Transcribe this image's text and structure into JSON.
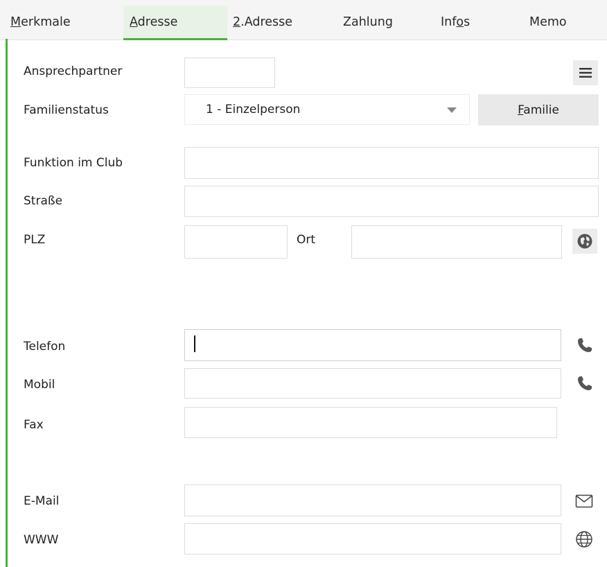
{
  "tabs": [
    {
      "label": "Merkmale",
      "mnemonic": "M",
      "rest": "erkmale",
      "active": false
    },
    {
      "label": "Adresse",
      "mnemonic": "A",
      "rest": "dresse",
      "active": true
    },
    {
      "label": "2.Adresse",
      "mnemonic": "2",
      "rest": ".Adresse",
      "active": false
    },
    {
      "label": "Zahlung",
      "mnemonic": "",
      "rest": "Zahlung",
      "active": false
    },
    {
      "label": "Infos",
      "pre": "Inf",
      "mnemonic": "o",
      "rest": "s",
      "active": false
    },
    {
      "label": "Memo",
      "mnemonic": "",
      "rest": "Memo",
      "active": false
    }
  ],
  "colors": {
    "accent": "#4caf3d",
    "active_tab_bg": "#e9f2e7",
    "button_bg": "#e9e9e9"
  },
  "form": {
    "ansprechpartner": {
      "label": "Ansprechpartner",
      "value": ""
    },
    "familienstatus": {
      "label": "Familienstatus",
      "value": "1 - Einzelperson"
    },
    "familie_button": {
      "label": "Familie",
      "mnemonic": "F",
      "rest": "amilie"
    },
    "funktion": {
      "label": "Funktion im Club",
      "value": ""
    },
    "strasse": {
      "label": "Straße",
      "value": ""
    },
    "plz": {
      "label": "PLZ",
      "value": ""
    },
    "ort": {
      "label": "Ort",
      "value": ""
    },
    "telefon": {
      "label": "Telefon",
      "value": ""
    },
    "mobil": {
      "label": "Mobil",
      "value": ""
    },
    "fax": {
      "label": "Fax",
      "value": ""
    },
    "email": {
      "label": "E-Mail",
      "value": ""
    },
    "www": {
      "label": "WWW",
      "value": ""
    }
  },
  "icons": {
    "menu": "hamburger-menu-icon",
    "map": "globe-location-icon",
    "phone": "phone-icon",
    "mail": "envelope-icon",
    "web": "globe-web-icon"
  }
}
